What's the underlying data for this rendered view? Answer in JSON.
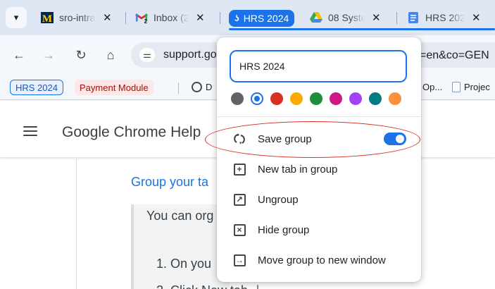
{
  "tabs": [
    {
      "title": "sro-intra",
      "favicon": "michigan-m-icon",
      "close": "✕"
    },
    {
      "title": "Inbox (2",
      "favicon": "gmail-icon",
      "badge": "2",
      "close": "✕"
    },
    {
      "title": "08 Syste",
      "favicon": "google-drive-icon",
      "close": "✕"
    },
    {
      "title": "HRS 202",
      "favicon": "google-docs-icon",
      "close": "✕"
    }
  ],
  "tab_group": {
    "name": "HRS 2024",
    "color": "#1a73e8"
  },
  "toolbar": {
    "back": "←",
    "forward": "→",
    "reload": "↻",
    "home": "⌂",
    "url_left": "support.go",
    "url_right": "=en&co=GEN"
  },
  "bookmarks": {
    "chip_group": "HRS 2024",
    "chip_payment": "Payment Module",
    "item_left": "D",
    "item_op": "Op...",
    "item_proj": "Projec"
  },
  "page": {
    "site_title": "Google Chrome Help",
    "section_link": "Group your ta",
    "callout_text": "You can org",
    "step1": "1. On you",
    "step2": "2. Click New tab ＋"
  },
  "popup": {
    "name_value": "HRS 2024",
    "colors": [
      "#5f6368",
      "#1a73e8",
      "#d93025",
      "#f9ab00",
      "#1e8e3e",
      "#d01884",
      "#a142f4",
      "#007b83",
      "#fa903e"
    ],
    "selected_color_index": 1,
    "items": [
      {
        "label": "Save group",
        "icon": "sync-group-icon",
        "toggle_on": true
      },
      {
        "label": "New tab in group",
        "icon": "new-tab-icon"
      },
      {
        "label": "Ungroup",
        "icon": "ungroup-icon"
      },
      {
        "label": "Hide group",
        "icon": "hide-group-icon"
      },
      {
        "label": "Move group to new window",
        "icon": "move-window-icon"
      }
    ]
  }
}
